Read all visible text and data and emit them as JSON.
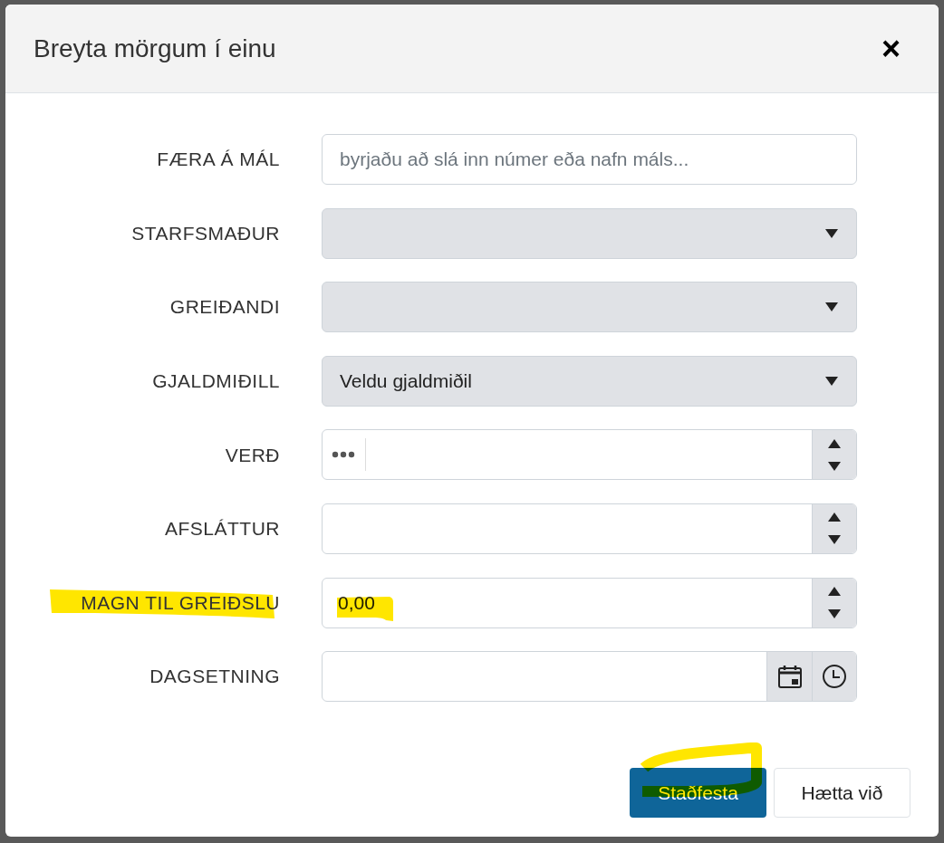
{
  "dialog": {
    "title": "Breyta mörgum í einu",
    "close": "×"
  },
  "fields": [
    {
      "label": "FÆRA Á MÁL",
      "kind": "text",
      "placeholder": "byrjaðu að slá inn númer eða nafn máls..."
    },
    {
      "label": "STARFSMAÐUR",
      "kind": "select"
    },
    {
      "label": "GREIÐANDI",
      "kind": "select"
    },
    {
      "label": "GJALDMIÐILL",
      "kind": "select",
      "value": "Veldu gjaldmiðil"
    },
    {
      "label": "VERÐ",
      "kind": "number",
      "menu": true
    },
    {
      "label": "AFSLÁTTUR",
      "kind": "number"
    },
    {
      "label": "MAGN TIL GREIÐSLU",
      "kind": "number",
      "value": "0,00",
      "highlighted": true,
      "label_highlighted": true
    },
    {
      "label": "DAGSETNING",
      "kind": "datetime"
    }
  ],
  "buttons": [
    {
      "label": "Staðfesta",
      "kind": "primary",
      "highlighted": true
    },
    {
      "label": "Hætta við",
      "kind": "secondary"
    }
  ]
}
